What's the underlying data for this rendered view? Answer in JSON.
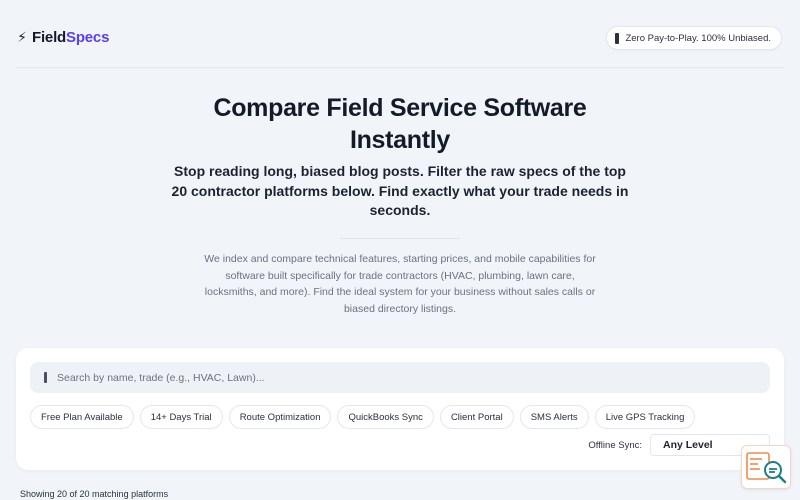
{
  "header": {
    "bolt_icon": "lightning-bolt-icon",
    "brand_part1": "Field",
    "brand_part2": "Specs",
    "badge_text": "Zero Pay-to-Play. 100% Unbiased."
  },
  "hero": {
    "title_line1": "Compare Field Service Software",
    "title_line2": "Instantly",
    "subtitle": "Stop reading long, biased blog posts. Filter the raw specs of the top 20 contractor platforms below. Find exactly what your trade needs in seconds.",
    "description": "We index and compare technical features, starting prices, and mobile capabilities for software built specifically for trade contractors (HVAC, plumbing, lawn care, locksmiths, and more). Find the ideal system for your business without sales calls or biased directory listings."
  },
  "filters": {
    "search_placeholder": "Search by name, trade (e.g., HVAC, Lawn)...",
    "search_value": "",
    "chips": [
      "Free Plan Available",
      "14+ Days Trial",
      "Route Optimization",
      "QuickBooks Sync",
      "Client Portal",
      "SMS Alerts",
      "Live GPS Tracking"
    ],
    "offline_label": "Offline Sync:",
    "offline_value": "Any Level"
  },
  "results_text": "Showing 20 of 20 matching platforms",
  "colors": {
    "accent": "#5a3ff0",
    "background": "#f1f4f9",
    "fab_orange": "#f08a4b",
    "fab_teal": "#1b7f86"
  }
}
